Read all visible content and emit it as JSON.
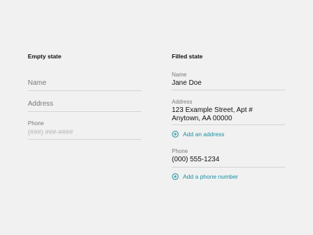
{
  "empty_state": {
    "heading": "Empty state",
    "name_placeholder": "Name",
    "address_placeholder": "Address",
    "phone_label": "Phone",
    "phone_placeholder": "(###) ###-####"
  },
  "filled_state": {
    "heading": "Filled state",
    "name_label": "Name",
    "name_value": "Jane Doe",
    "address_label": "Address",
    "address_line1": "123 Example Street, Apt #",
    "address_line2": "Anytown, AA 00000",
    "add_address_label": "Add an address",
    "phone_label": "Phone",
    "phone_value": "(000) 555-1234",
    "add_phone_label": "Add a phone number"
  },
  "colors": {
    "accent": "#1a8fa3",
    "background": "#f1f1f1",
    "divider": "#d3d3d3"
  },
  "icons": {
    "add": "plus-circle-icon"
  }
}
